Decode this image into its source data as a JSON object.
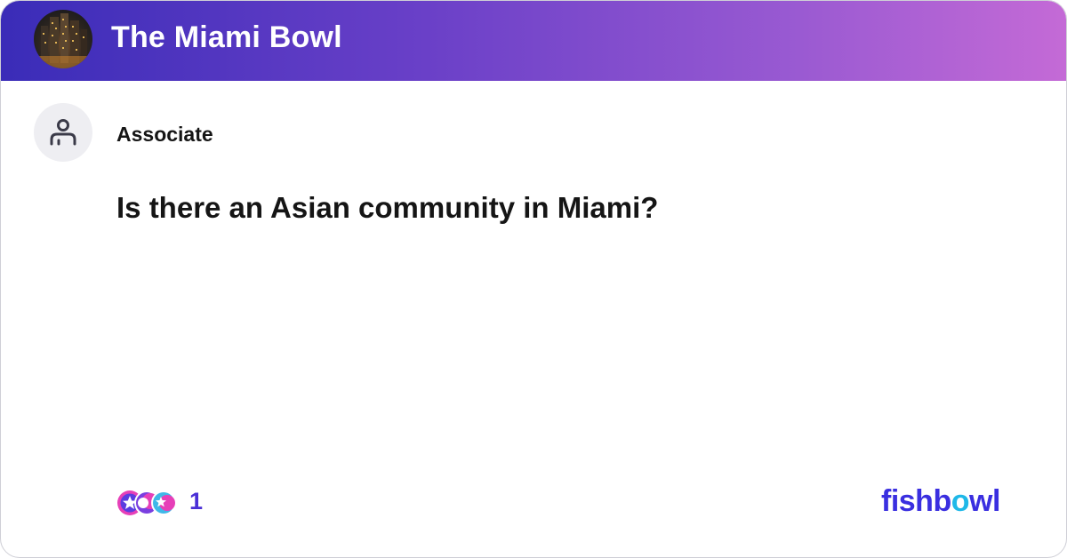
{
  "header": {
    "bowl_name": "The Miami Bowl",
    "bowl_avatar": "city-skyline-photo"
  },
  "post": {
    "author": "Associate",
    "author_avatar_icon": "person-icon",
    "title": "Is there an Asian community in Miami?"
  },
  "footer": {
    "reaction_icons": [
      "star-reaction-icon",
      "moon-reaction-icon",
      "star-reaction-icon"
    ],
    "reaction_count": "1",
    "brand": {
      "prefix": "fishb",
      "o": "o",
      "suffix": "wl"
    }
  },
  "colors": {
    "header_gradient_start": "#3a2cb8",
    "header_gradient_end": "#c46ad6",
    "brand": "#3a2fe0",
    "brand_accent": "#1fb8e8",
    "reaction_count": "#4a2fd6"
  }
}
